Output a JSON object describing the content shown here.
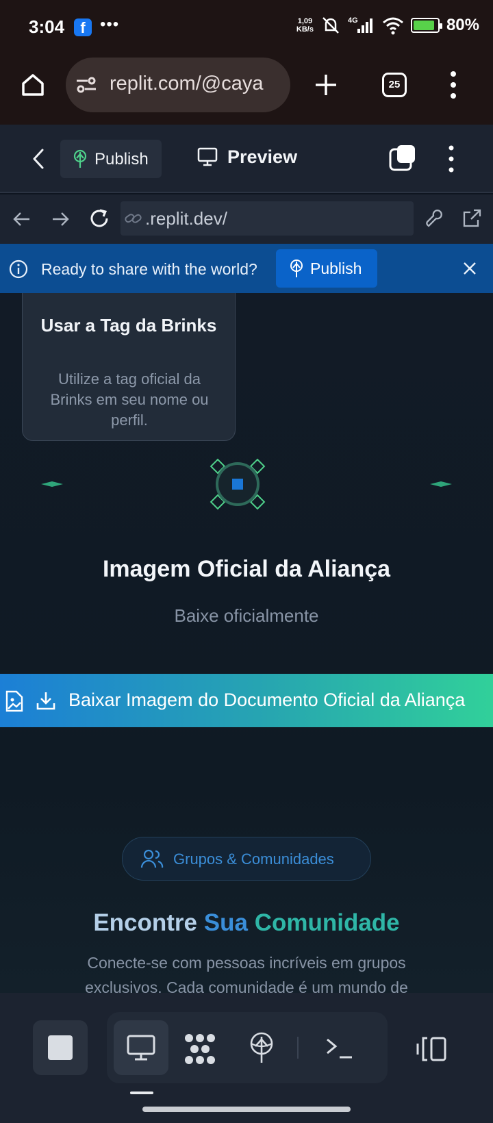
{
  "status_bar": {
    "time": "3:04",
    "facebook_badge": "f",
    "overflow": "•••",
    "net_speed_value": "1,09",
    "net_speed_unit": "KB/s",
    "network": "4G",
    "battery": "80%",
    "battery_level": 0.8
  },
  "browser": {
    "url": "replit.com/@caya",
    "tab_count": "25"
  },
  "replit_header": {
    "publish_label": "Publish",
    "preview_label": "Preview"
  },
  "address_bar": {
    "url": ".replit.dev/"
  },
  "banner": {
    "message": "Ready to share with the world?",
    "publish_label": "Publish"
  },
  "content": {
    "card": {
      "title": "Usar a Tag da Brinks",
      "description": "Utilize a tag oficial da Brinks em seu nome ou perfil."
    },
    "section_title": "Imagem Oficial da Aliança",
    "section_subtitle": "Baixe oficialmente",
    "download_button": "Baixar Imagem do Documento Oficial da Aliança",
    "pill_label": "Grupos & Comunidades",
    "heading_word_1": "Encontre",
    "heading_word_2": "Sua",
    "heading_word_3": "Comunidade",
    "paragraph": "Conecte-se com pessoas incríveis em grupos exclusivos. Cada comunidade é um mundo de"
  },
  "colors": {
    "banner": "#0c4d92",
    "accent_blue": "#3a8ed9",
    "accent_teal": "#2fb6a7",
    "divider_green": "#2fa57a"
  }
}
